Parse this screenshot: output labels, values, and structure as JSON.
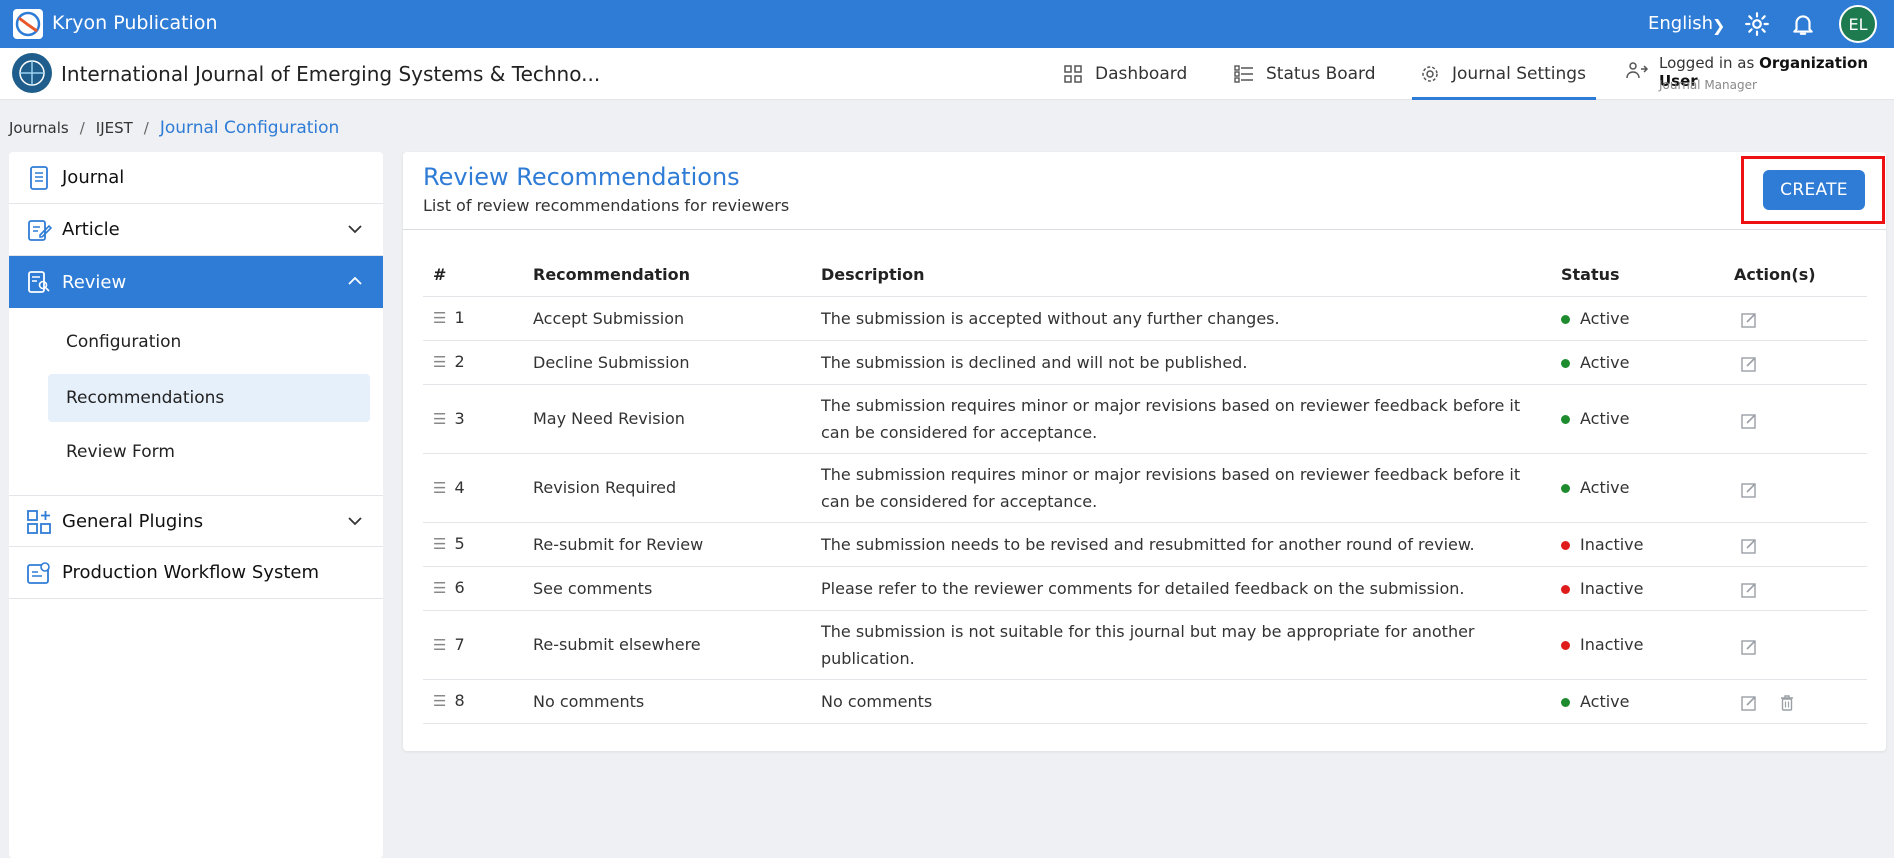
{
  "topbar": {
    "brand": "Kryon Publication",
    "language": "English",
    "avatar_initials": "EL"
  },
  "secbar": {
    "journal_title": "International Journal of Emerging Systems & Techno...",
    "nav": {
      "dashboard": "Dashboard",
      "status_board": "Status Board",
      "journal_settings": "Journal Settings"
    },
    "logged_prefix": "Logged in as",
    "logged_user": "Organization User",
    "role": "Journal Manager"
  },
  "breadcrumb": {
    "journals": "Journals",
    "code": "IJEST",
    "current": "Journal Configuration"
  },
  "sidebar": {
    "journal": "Journal",
    "article": "Article",
    "review": "Review",
    "sub": {
      "configuration": "Configuration",
      "recommendations": "Recommendations",
      "review_form": "Review Form"
    },
    "general_plugins": "General Plugins",
    "production": "Production Workflow System"
  },
  "main": {
    "title": "Review Recommendations",
    "subtitle": "List of review recommendations for reviewers",
    "create_label": "CREATE",
    "columns": {
      "num": "#",
      "recommendation": "Recommendation",
      "description": "Description",
      "status": "Status",
      "actions": "Action(s)"
    },
    "rows": [
      {
        "num": "1",
        "recommendation": "Accept Submission",
        "description": "The submission is accepted without any further changes.",
        "status": "Active"
      },
      {
        "num": "2",
        "recommendation": "Decline Submission",
        "description": "The submission is declined and will not be published.",
        "status": "Active"
      },
      {
        "num": "3",
        "recommendation": "May Need Revision",
        "description": "The submission requires minor or major revisions based on reviewer feedback before it can be considered for acceptance.",
        "status": "Active"
      },
      {
        "num": "4",
        "recommendation": "Revision Required",
        "description": "The submission requires minor or major revisions based on reviewer feedback before it can be considered for acceptance.",
        "status": "Active"
      },
      {
        "num": "5",
        "recommendation": "Re-submit for Review",
        "description": "The submission needs to be revised and resubmitted for another round of review.",
        "status": "Inactive"
      },
      {
        "num": "6",
        "recommendation": "See comments",
        "description": "Please refer to the reviewer comments for detailed feedback on the submission.",
        "status": "Inactive"
      },
      {
        "num": "7",
        "recommendation": "Re-submit elsewhere",
        "description": "The submission is not suitable for this journal but may be appropriate for another publication.",
        "status": "Inactive"
      },
      {
        "num": "8",
        "recommendation": "No comments",
        "description": "No comments",
        "status": "Active"
      }
    ]
  },
  "colors": {
    "primary": "#2f7cd6",
    "active_dot": "#1e8c2e",
    "inactive_dot": "#e01b1b",
    "highlight_box": "#e11111"
  }
}
